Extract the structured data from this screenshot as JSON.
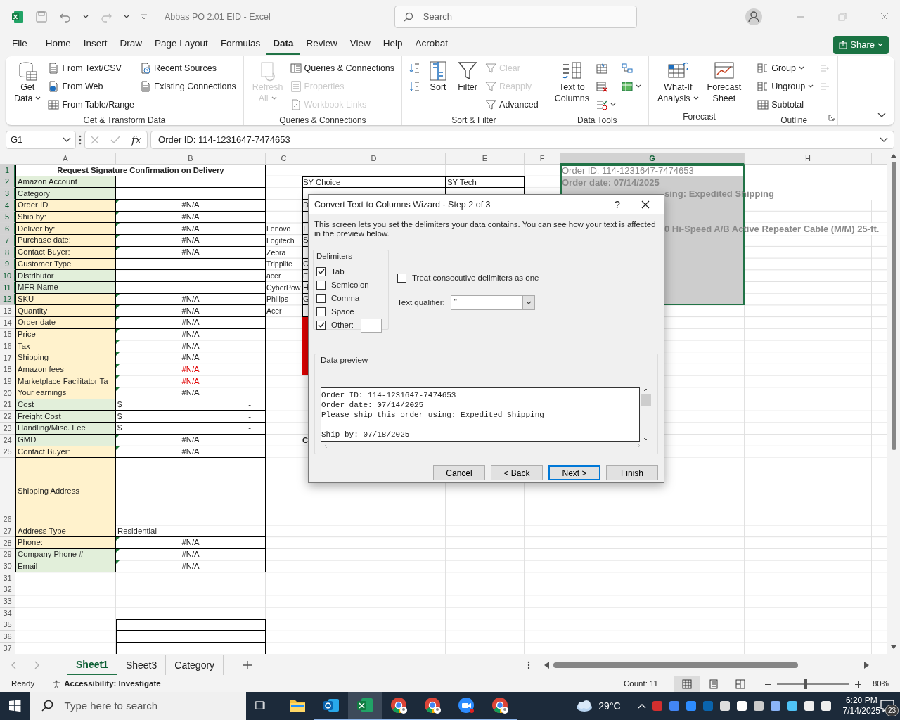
{
  "window": {
    "title": "Abbas PO 2.01 EID - Excel",
    "search_placeholder": "Search"
  },
  "menu_tabs": [
    {
      "label": "File",
      "selected": false
    },
    {
      "label": "Home",
      "selected": false
    },
    {
      "label": "Insert",
      "selected": false
    },
    {
      "label": "Draw",
      "selected": false
    },
    {
      "label": "Page Layout",
      "selected": false
    },
    {
      "label": "Formulas",
      "selected": false
    },
    {
      "label": "Data",
      "selected": true
    },
    {
      "label": "Review",
      "selected": false
    },
    {
      "label": "View",
      "selected": false
    },
    {
      "label": "Help",
      "selected": false
    },
    {
      "label": "Acrobat",
      "selected": false
    }
  ],
  "share": {
    "label": "Share"
  },
  "ribbon": {
    "groups": [
      {
        "label": "Get & Transform Data",
        "launcher": false,
        "columns": [
          [
            {
              "kind": "large",
              "lines": [
                "Get",
                "Data"
              ],
              "dropdown": true,
              "disabled": false
            }
          ],
          [
            {
              "kind": "small",
              "label": "From Text/CSV",
              "dropdown": false,
              "disabled": false
            },
            {
              "kind": "small",
              "label": "From Web",
              "dropdown": false,
              "disabled": false
            },
            {
              "kind": "small",
              "label": "From Table/Range",
              "dropdown": false,
              "disabled": false
            }
          ],
          [
            {
              "kind": "small",
              "label": "Recent Sources",
              "dropdown": false,
              "disabled": false
            },
            {
              "kind": "small",
              "label": "Existing Connections",
              "dropdown": false,
              "disabled": false
            }
          ]
        ]
      },
      {
        "label": "Queries & Connections",
        "launcher": false,
        "columns": [
          [
            {
              "kind": "large",
              "lines": [
                "Refresh",
                "All"
              ],
              "dropdown": true,
              "disabled": true
            }
          ],
          [
            {
              "kind": "small",
              "label": "Queries & Connections",
              "dropdown": false,
              "disabled": false
            },
            {
              "kind": "small",
              "label": "Properties",
              "dropdown": false,
              "disabled": true
            },
            {
              "kind": "small",
              "label": "Workbook Links",
              "dropdown": false,
              "disabled": true
            }
          ]
        ]
      },
      {
        "label": "Sort & Filter",
        "launcher": false,
        "columns": [
          [
            {
              "kind": "icon",
              "dropdown": false,
              "disabled": false
            },
            {
              "kind": "icon",
              "dropdown": false,
              "disabled": false
            }
          ],
          [
            {
              "kind": "large",
              "lines": [
                "Sort"
              ],
              "dropdown": false,
              "disabled": false
            }
          ],
          [
            {
              "kind": "large",
              "lines": [
                "Filter"
              ],
              "dropdown": false,
              "disabled": false
            }
          ],
          [
            {
              "kind": "small",
              "label": "Clear",
              "dropdown": false,
              "disabled": true
            },
            {
              "kind": "small",
              "label": "Reapply",
              "dropdown": false,
              "disabled": true
            },
            {
              "kind": "small",
              "label": "Advanced",
              "dropdown": false,
              "disabled": false
            }
          ]
        ]
      },
      {
        "label": "Data Tools",
        "launcher": false,
        "columns": [
          [
            {
              "kind": "large",
              "lines": [
                "Text to",
                "Columns"
              ],
              "dropdown": false,
              "disabled": false
            }
          ],
          [
            {
              "kind": "icon",
              "dropdown": false,
              "disabled": false
            },
            {
              "kind": "icon",
              "dropdown": false,
              "disabled": false
            },
            {
              "kind": "icon",
              "dropdown": true,
              "disabled": false
            }
          ],
          [
            {
              "kind": "icon",
              "dropdown": false,
              "disabled": false
            },
            {
              "kind": "icon",
              "dropdown": true,
              "disabled": false
            }
          ]
        ]
      },
      {
        "label": "Forecast",
        "launcher": false,
        "columns": [
          [
            {
              "kind": "large",
              "lines": [
                "What-If",
                "Analysis"
              ],
              "dropdown": true,
              "disabled": false
            }
          ],
          [
            {
              "kind": "large",
              "lines": [
                "Forecast",
                "Sheet"
              ],
              "dropdown": false,
              "disabled": false
            }
          ]
        ]
      },
      {
        "label": "Outline",
        "launcher": true,
        "columns": [
          [
            {
              "kind": "small",
              "label": "Group",
              "dropdown": true,
              "disabled": false
            },
            {
              "kind": "small",
              "label": "Ungroup",
              "dropdown": true,
              "disabled": false
            },
            {
              "kind": "small",
              "label": "Subtotal",
              "dropdown": false,
              "disabled": false
            }
          ],
          [
            {
              "kind": "icon",
              "dropdown": false,
              "disabled": true
            },
            {
              "kind": "icon",
              "dropdown": false,
              "disabled": true
            }
          ]
        ]
      }
    ]
  },
  "formula_bar": {
    "name_box": "G1",
    "function_label": "fx",
    "formula": "Order ID: 114-1231647-7474653"
  },
  "sheet": {
    "columns": [
      {
        "label": "A",
        "selected": false
      },
      {
        "label": "B",
        "selected": false
      },
      {
        "label": "C",
        "selected": false
      },
      {
        "label": "D",
        "selected": false
      },
      {
        "label": "E",
        "selected": false
      },
      {
        "label": "F",
        "selected": false
      },
      {
        "label": "G",
        "selected": true
      },
      {
        "label": "H",
        "selected": false
      }
    ],
    "rows": [
      {
        "label": "1",
        "selected": true,
        "cells": [
          {
            "kind": "title",
            "text": "Request Signature Confirmation on Delivery",
            "flag": false,
            "bold": true
          },
          "",
          "",
          "",
          "",
          "",
          {
            "kind": "faded",
            "text": "Order ID: 114-1231647-7474653",
            "flag": false,
            "bold": false
          }
        ]
      },
      {
        "label": "2",
        "selected": true,
        "cells": [
          {
            "kind": "label",
            "text": "Amazon Account",
            "color": "#e2efda",
            "flag": false,
            "bold": false
          },
          "",
          "",
          {
            "kind": "text",
            "text": "SY Choice",
            "flag": false,
            "bold": false
          },
          {
            "kind": "text",
            "text": "SY Tech",
            "flag": false,
            "bold": false
          },
          "",
          {
            "kind": "faded",
            "text": "Order date: 07/14/2025",
            "flag": false,
            "bold": true
          }
        ]
      },
      {
        "label": "3",
        "selected": true,
        "cells": [
          {
            "kind": "label",
            "text": "Category",
            "color": "#e2efda",
            "flag": false,
            "bold": false
          },
          "",
          "",
          "",
          "",
          "",
          {
            "kind": "faded",
            "text": "sing: Expedited Shipping",
            "flag": false,
            "bold": true
          }
        ]
      },
      {
        "label": "4",
        "selected": true,
        "cells": [
          {
            "kind": "label",
            "text": "Order ID",
            "color": "#fff2cc",
            "flag": false,
            "bold": false
          },
          {
            "kind": "value",
            "text": "#N/A",
            "flag": true,
            "bold": false
          },
          "",
          {
            "kind": "text",
            "text": "D",
            "flag": false,
            "bold": false
          }
        ]
      },
      {
        "label": "5",
        "selected": true,
        "cells": [
          {
            "kind": "label",
            "text": "Ship by:",
            "color": "#fff2cc",
            "flag": false,
            "bold": false
          },
          {
            "kind": "value",
            "text": "#N/A",
            "flag": true,
            "bold": false
          }
        ]
      },
      {
        "label": "6",
        "selected": true,
        "cells": [
          {
            "kind": "label",
            "text": "Deliver by:",
            "color": "#fff2cc",
            "flag": false,
            "bold": false
          },
          {
            "kind": "value",
            "text": "#N/A",
            "flag": true,
            "bold": false
          },
          {
            "kind": "text",
            "text": "Lenovo",
            "flag": false,
            "bold": false
          },
          {
            "kind": "text",
            "text": "I",
            "flag": false,
            "bold": false
          },
          "",
          "",
          {
            "kind": "faded",
            "text": "0 Hi-Speed A/B Active Repeater Cable (M/M) 25-ft.",
            "flag": false,
            "bold": true
          }
        ]
      },
      {
        "label": "7",
        "selected": true,
        "cells": [
          {
            "kind": "label",
            "text": "Purchase date:",
            "color": "#fff2cc",
            "flag": false,
            "bold": false
          },
          {
            "kind": "value",
            "text": "#N/A",
            "flag": true,
            "bold": false
          },
          {
            "kind": "text",
            "text": "Logitech",
            "flag": false,
            "bold": false
          },
          {
            "kind": "text",
            "text": "S",
            "flag": false,
            "bold": false
          }
        ]
      },
      {
        "label": "8",
        "selected": true,
        "cells": [
          {
            "kind": "label",
            "text": "Contact Buyer:",
            "color": "#fff2cc",
            "flag": false,
            "bold": false
          },
          {
            "kind": "value",
            "text": "#N/A",
            "flag": true,
            "bold": false
          },
          {
            "kind": "text",
            "text": "Zebra",
            "flag": false,
            "bold": false
          }
        ]
      },
      {
        "label": "9",
        "selected": true,
        "cells": [
          {
            "kind": "label",
            "text": "Customer Type",
            "color": "#fff2cc",
            "flag": false,
            "bold": false
          },
          "",
          {
            "kind": "text",
            "text": "Tripplite",
            "flag": false,
            "bold": false
          },
          {
            "kind": "text",
            "text": "C",
            "flag": false,
            "bold": false
          }
        ]
      },
      {
        "label": "10",
        "selected": true,
        "cells": [
          {
            "kind": "label",
            "text": "Distributor",
            "color": "#e2efda",
            "flag": false,
            "bold": false
          },
          "",
          {
            "kind": "text",
            "text": "acer",
            "flag": false,
            "bold": false
          },
          {
            "kind": "text",
            "text": "F",
            "flag": false,
            "bold": false
          }
        ]
      },
      {
        "label": "11",
        "selected": true,
        "cells": [
          {
            "kind": "label",
            "text": "MFR Name",
            "color": "#e2efda",
            "flag": false,
            "bold": false
          },
          "",
          {
            "kind": "text",
            "text": "CyberPow",
            "flag": false,
            "bold": false
          },
          {
            "kind": "text",
            "text": "H",
            "flag": false,
            "bold": false
          }
        ]
      },
      {
        "label": "12",
        "selected": true,
        "cells": [
          {
            "kind": "label",
            "text": "SKU",
            "color": "#fff2cc",
            "flag": false,
            "bold": false
          },
          {
            "kind": "value",
            "text": "#N/A",
            "flag": true,
            "bold": false
          },
          {
            "kind": "text",
            "text": "Philips",
            "flag": false,
            "bold": false
          },
          {
            "kind": "text",
            "text": "G",
            "flag": false,
            "bold": false
          }
        ]
      },
      {
        "label": "13",
        "selected": false,
        "cells": [
          {
            "kind": "label",
            "text": "Quantity",
            "color": "#fff2cc",
            "flag": false,
            "bold": false
          },
          {
            "kind": "value",
            "text": "#N/A",
            "flag": true,
            "bold": false
          },
          {
            "kind": "text",
            "text": "Acer",
            "flag": false,
            "bold": false
          }
        ]
      },
      {
        "label": "14",
        "selected": false,
        "cells": [
          {
            "kind": "label",
            "text": "Order date",
            "color": "#fff2cc",
            "flag": false,
            "bold": false
          },
          {
            "kind": "value",
            "text": "#N/A",
            "flag": true,
            "bold": false
          },
          "",
          {
            "kind": "fill",
            "color": "#e00000"
          }
        ]
      },
      {
        "label": "15",
        "selected": false,
        "cells": [
          {
            "kind": "label",
            "text": "Price",
            "color": "#fff2cc",
            "flag": false,
            "bold": false
          },
          {
            "kind": "value",
            "text": "#N/A",
            "flag": true,
            "bold": false
          },
          "",
          {
            "kind": "fill",
            "color": "#e00000"
          }
        ]
      },
      {
        "label": "16",
        "selected": false,
        "cells": [
          {
            "kind": "label",
            "text": "Tax",
            "color": "#fff2cc",
            "flag": false,
            "bold": false
          },
          {
            "kind": "value",
            "text": "#N/A",
            "flag": true,
            "bold": false
          },
          "",
          {
            "kind": "fill",
            "color": "#e00000"
          }
        ]
      },
      {
        "label": "17",
        "selected": false,
        "cells": [
          {
            "kind": "label",
            "text": "Shipping",
            "color": "#fff2cc",
            "flag": false,
            "bold": false
          },
          {
            "kind": "value",
            "text": "#N/A",
            "flag": true,
            "bold": false
          },
          "",
          {
            "kind": "fill",
            "color": "#e00000"
          }
        ]
      },
      {
        "label": "18",
        "selected": false,
        "cells": [
          {
            "kind": "label",
            "text": "Amazon fees",
            "color": "#fff2cc",
            "flag": false,
            "bold": false
          },
          {
            "kind": "alert",
            "text": "#N/A",
            "flag": true,
            "bold": false
          },
          "",
          {
            "kind": "fill",
            "color": "#e00000"
          }
        ]
      },
      {
        "label": "19",
        "selected": false,
        "cells": [
          {
            "kind": "label",
            "text": "Marketplace Facilitator Ta",
            "color": "#fff2cc",
            "flag": false,
            "bold": false
          },
          {
            "kind": "alert",
            "text": "#N/A",
            "flag": true,
            "bold": false
          }
        ]
      },
      {
        "label": "20",
        "selected": false,
        "cells": [
          {
            "kind": "label",
            "text": "Your earnings",
            "color": "#fff2cc",
            "flag": false,
            "bold": false
          },
          {
            "kind": "value",
            "text": "#N/A",
            "flag": true,
            "bold": false
          }
        ]
      },
      {
        "label": "21",
        "selected": false,
        "cells": [
          {
            "kind": "label",
            "text": "Cost",
            "color": "#e2efda",
            "flag": false,
            "bold": false
          },
          {
            "kind": "currency",
            "text": "$",
            "text_right": "-",
            "flag": false,
            "bold": false
          }
        ]
      },
      {
        "label": "22",
        "selected": false,
        "cells": [
          {
            "kind": "label",
            "text": "Freight Cost",
            "color": "#e2efda",
            "flag": false,
            "bold": false
          },
          {
            "kind": "currency",
            "text": "$",
            "text_right": "-",
            "flag": false,
            "bold": false
          }
        ]
      },
      {
        "label": "23",
        "selected": false,
        "cells": [
          {
            "kind": "label",
            "text": "Handling/Misc. Fee",
            "color": "#e2efda",
            "flag": false,
            "bold": false
          },
          {
            "kind": "currency",
            "text": "$",
            "text_right": "-",
            "flag": false,
            "bold": false
          }
        ]
      },
      {
        "label": "24",
        "selected": false,
        "cells": [
          {
            "kind": "label",
            "text": "GMD",
            "color": "#e2efda",
            "flag": false,
            "bold": false
          },
          {
            "kind": "value",
            "text": "#N/A",
            "flag": true,
            "bold": false
          },
          "",
          {
            "kind": "text",
            "text": "C",
            "flag": false,
            "bold": true
          }
        ]
      },
      {
        "label": "25",
        "selected": false,
        "cells": [
          {
            "kind": "label",
            "text": "Contact Buyer:",
            "color": "#fff2cc",
            "flag": false,
            "bold": false
          },
          {
            "kind": "value",
            "text": "#N/A",
            "flag": true,
            "bold": false
          }
        ]
      },
      {
        "label": "26",
        "selected": false,
        "cells": [
          {
            "kind": "label",
            "text": "Shipping Address",
            "color": "#fff2cc",
            "flag": false,
            "bold": false
          }
        ]
      },
      {
        "label": "27",
        "selected": false,
        "cells": [
          {
            "kind": "label",
            "text": "Address Type",
            "color": "#fff2cc",
            "flag": false,
            "bold": false
          },
          {
            "kind": "text",
            "text": "Residential",
            "flag": false,
            "bold": false
          }
        ]
      },
      {
        "label": "28",
        "selected": false,
        "cells": [
          {
            "kind": "label",
            "text": "Phone:",
            "color": "#fff2cc",
            "flag": false,
            "bold": false
          },
          {
            "kind": "value",
            "text": "#N/A",
            "flag": true,
            "bold": false
          }
        ]
      },
      {
        "label": "29",
        "selected": false,
        "cells": [
          {
            "kind": "label",
            "text": "Company Phone #",
            "color": "#e2efda",
            "flag": false,
            "bold": false
          },
          {
            "kind": "value",
            "text": "#N/A",
            "flag": true,
            "bold": false
          }
        ]
      },
      {
        "label": "30",
        "selected": false,
        "cells": [
          {
            "kind": "label",
            "text": "Email",
            "color": "#e2efda",
            "flag": false,
            "bold": false
          },
          {
            "kind": "value",
            "text": "#N/A",
            "flag": true,
            "bold": false
          }
        ]
      },
      {
        "label": "31",
        "selected": false,
        "cells": []
      },
      {
        "label": "32",
        "selected": false,
        "cells": []
      },
      {
        "label": "33",
        "selected": false,
        "cells": []
      },
      {
        "label": "34",
        "selected": false,
        "cells": []
      },
      {
        "label": "35",
        "selected": false,
        "cells": []
      },
      {
        "label": "36",
        "selected": false,
        "cells": []
      },
      {
        "label": "37",
        "selected": false,
        "cells": []
      }
    ]
  },
  "dialog": {
    "title": "Convert Text to Columns Wizard - Step 2 of 3",
    "help": "?",
    "intro": "This screen lets you set the delimiters your data contains.  You can see how your text is affected in the preview below.",
    "delimiters_title": "Delimiters",
    "delimiters": [
      {
        "label": "Tab",
        "checked": true
      },
      {
        "label": "Semicolon",
        "checked": false
      },
      {
        "label": "Comma",
        "checked": false
      },
      {
        "label": "Space",
        "checked": false
      },
      {
        "label": "Other:",
        "checked": true
      }
    ],
    "consecutive": {
      "label": "Treat consecutive delimiters as one",
      "checked": false
    },
    "qualifier": {
      "label": "Text qualifier:",
      "value": "\""
    },
    "preview_title": "Data preview",
    "preview_lines": [
      {
        "text": "Order ID: 114-1231647-7474653",
        "blank_before": false
      },
      {
        "text": "Order date: 07/14/2025",
        "blank_before": false
      },
      {
        "text": "Please ship this order using: Expedited Shipping",
        "blank_before": false
      },
      {
        "text": "Ship by: 07/18/2025",
        "blank_before": true
      }
    ],
    "buttons": [
      {
        "label": "Cancel",
        "default": false
      },
      {
        "label": "< Back",
        "default": false
      },
      {
        "label": "Next >",
        "default": true
      },
      {
        "label": "Finish",
        "default": false
      }
    ]
  },
  "sheet_tabs": [
    {
      "label": "Sheet1",
      "selected": true
    },
    {
      "label": "Sheet3",
      "selected": false
    },
    {
      "label": "Category",
      "selected": false
    }
  ],
  "status_bar": {
    "mode": "Ready",
    "accessibility": "Accessibility: Investigate",
    "count": "Count: 11",
    "views": [
      {
        "selected": true
      },
      {
        "selected": false
      },
      {
        "selected": false
      }
    ],
    "zoom": {
      "level": 0.38,
      "reading": "80%"
    }
  },
  "taskbar": {
    "search_placeholder": "Type here to search",
    "apps": [
      {
        "kind": "folder",
        "running": false,
        "active": false
      },
      {
        "kind": "mail",
        "running": true,
        "active": false
      },
      {
        "kind": "sheet",
        "running": true,
        "active": true
      },
      {
        "kind": "browser",
        "running": true,
        "active": false
      },
      {
        "kind": "browser",
        "running": true,
        "active": false
      },
      {
        "kind": "video",
        "running": true,
        "active": false
      },
      {
        "kind": "browser",
        "running": true,
        "active": false
      }
    ],
    "weather": "29°C",
    "time": "6:20 PM",
    "date": "7/14/2025",
    "notifications": "23"
  }
}
